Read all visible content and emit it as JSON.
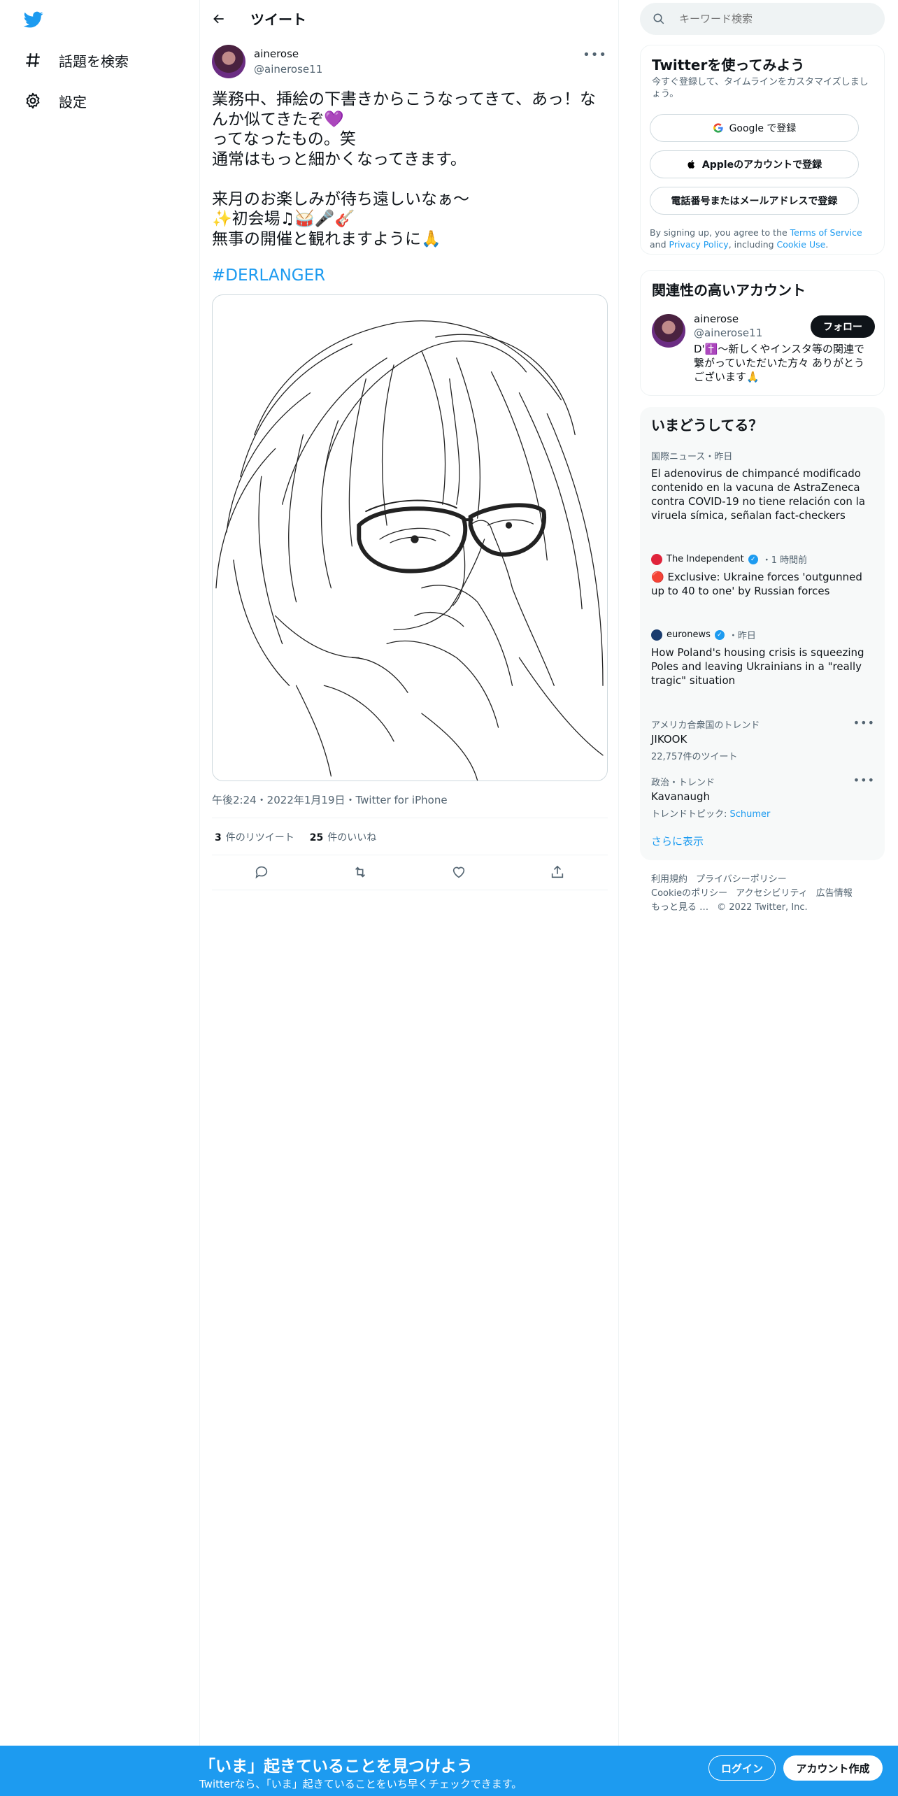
{
  "header": {
    "title": "ツイート"
  },
  "nav": {
    "explore": "話題を検索",
    "settings": "設定"
  },
  "tweet": {
    "author_name": "ainerose",
    "author_handle": "@ainerose11",
    "text": "業務中、挿絵の下書きからこうなってきて、あっ！なんか似てきたぞ💜\nってなったもの。笑\n通常はもっと細かくなってきます。\n\n来月のお楽しみが待ち遠しいなぁ〜\n✨初会場♫🥁🎤🎸\n無事の開催と観れますように🙏",
    "hashtag": "#DERLANGER",
    "meta": "午後2:24・2022年1月19日・Twitter for iPhone",
    "retweets_count": "3",
    "retweets_label": "件のリツイート",
    "likes_count": "25",
    "likes_label": "件のいいね"
  },
  "search": {
    "placeholder": "キーワード検索"
  },
  "signup": {
    "title": "Twitterを使ってみよう",
    "subtitle": "今すぐ登録して、タイムラインをカスタマイズしましょう。",
    "google": "Google で登録",
    "apple": "Appleのアカウントで登録",
    "phone": "電話番号またはメールアドレスで登録",
    "legal_prefix": "By signing up, you agree to the ",
    "terms": "Terms of Service",
    "and": " and ",
    "privacy": "Privacy Policy",
    "including": ", including ",
    "cookie": "Cookie Use",
    "period": "."
  },
  "related": {
    "title": "関連性の高いアカウント",
    "name": "ainerose",
    "handle": "@ainerose11",
    "follow": "フォロー",
    "bio": "D'✝️〜新しくやインスタ等の関連で繋がっていただいた方々 ありがとうございます🙏"
  },
  "trends": {
    "title": "いまどうしてる？",
    "items": [
      {
        "category": "国際ニュース・昨日",
        "headline": "El adenovirus de chimpancé modificado contenido en la vacuna de AstraZeneca contra COVID-19 no tiene relación con la viruela símica, señalan fact-checkers"
      },
      {
        "source": "The Independent",
        "time": "・1 時間前",
        "headline": "🔴 Exclusive: Ukraine forces 'outgunned up to 40 to one' by Russian forces"
      },
      {
        "source": "euronews",
        "time": "・昨日",
        "headline": "How Poland's housing crisis is squeezing Poles and leaving Ukrainians in a \"really tragic\" situation"
      },
      {
        "category": "アメリカ合衆国のトレンド",
        "headline": "JIKOOK",
        "count": "22,757件のツイート"
      },
      {
        "category": "政治・トレンド",
        "headline": "Kavanaugh",
        "topic_prefix": "トレンドトピック: ",
        "topic": "Schumer"
      }
    ],
    "show_more": "さらに表示"
  },
  "footer": {
    "links": [
      "利用規約",
      "プライバシーポリシー",
      "Cookieのポリシー",
      "アクセシビリティ",
      "広告情報",
      "もっと見る …"
    ],
    "copyright": "© 2022 Twitter, Inc."
  },
  "banner": {
    "title": "「いま」起きていることを見つけよう",
    "subtitle": "Twitterなら、「いま」起きていることをいち早くチェックできます。",
    "login": "ログイン",
    "signup": "アカウント作成"
  },
  "colors": {
    "accent": "#1d9bf0",
    "text": "#0f1419",
    "muted": "#536471"
  }
}
